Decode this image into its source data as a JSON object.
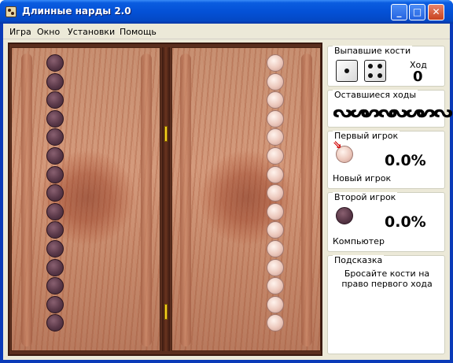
{
  "window": {
    "title": "Длинные нарды 2.0",
    "minimize_label": "_",
    "maximize_label": "□",
    "close_label": "✕"
  },
  "menu": {
    "items": [
      "Игра",
      "Окно",
      "Установки",
      "Помощь"
    ]
  },
  "board": {
    "left_checkers": 15,
    "right_checkers": 15,
    "left_color": "dark",
    "right_color": "light"
  },
  "dice_panel": {
    "title": "Выпавшие кости",
    "die1": 1,
    "die2": 4,
    "move_label": "Ход",
    "move_number": "0"
  },
  "moves_panel": {
    "title": "Оставшиеся ходы",
    "glyphs": [
      "ᔓᔕ",
      "ᔕᔓ",
      "ᔓᔕ",
      "ᔕᔓ"
    ]
  },
  "player1": {
    "title": "Первый игрок",
    "percent": "0.0%",
    "name": "Новый игрок",
    "marker": "⇘"
  },
  "player2": {
    "title": "Второй игрок",
    "percent": "0.0%",
    "name": "Компьютер"
  },
  "hint": {
    "title": "Подсказка",
    "text": "Бросайте кости на право первого хода"
  },
  "colors": {
    "titlebar": "#0451d6",
    "dark_checker": "#5a3848",
    "light_checker": "#ecc8bc",
    "board_wood": "#c79072"
  }
}
